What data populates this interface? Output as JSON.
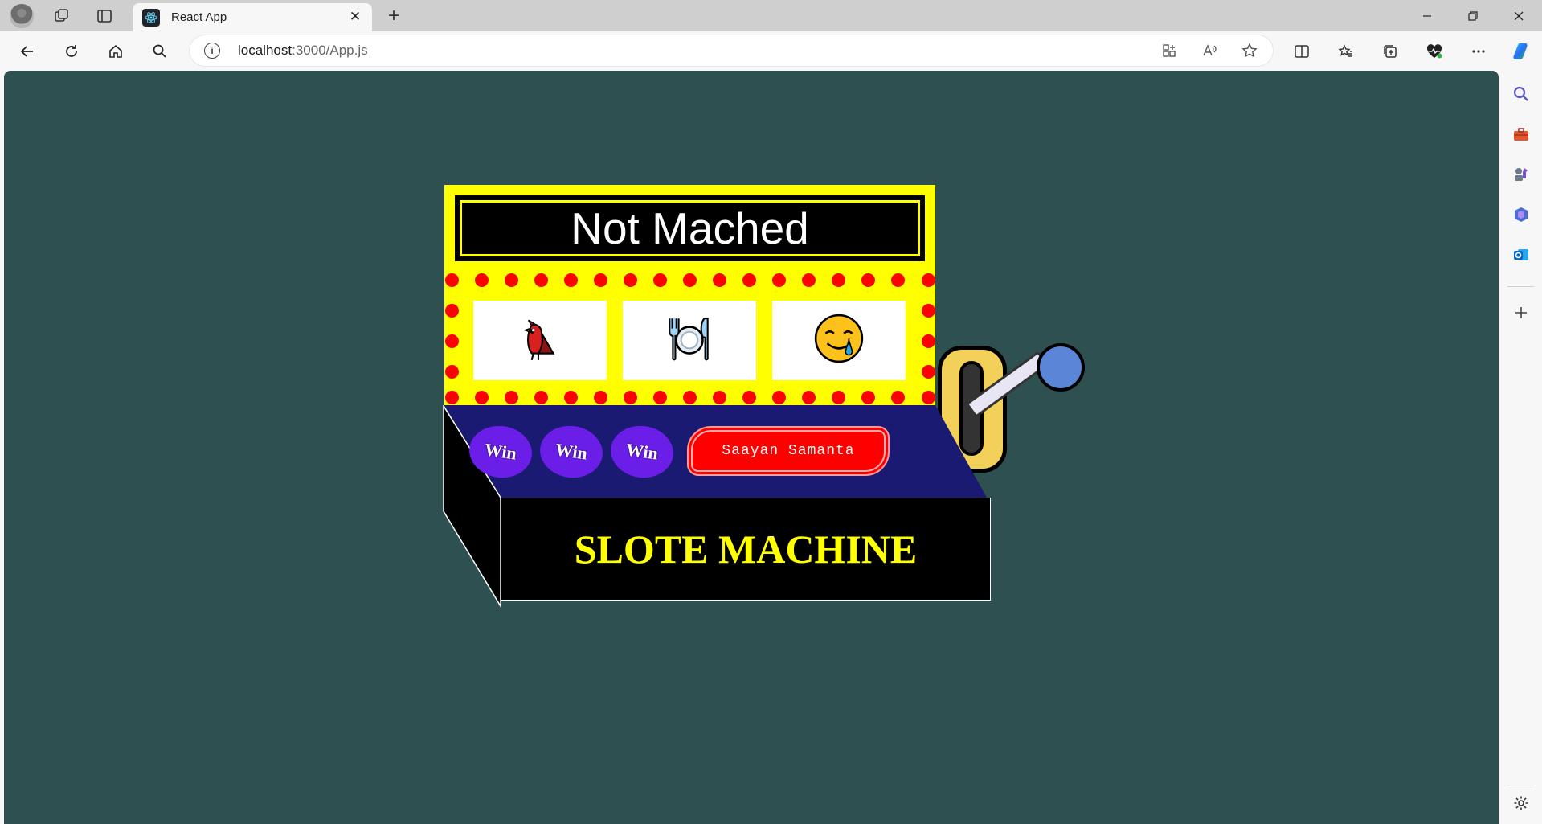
{
  "browser": {
    "tab_title": "React App",
    "url_host": "localhost",
    "url_rest": ":3000/App.js",
    "new_tab_glyph": "+",
    "close_tab_glyph": "✕"
  },
  "icons": {
    "avatar": "profile-avatar",
    "workspaces": "workspaces-icon",
    "tab_actions": "tab-actions-icon",
    "back": "back-icon",
    "refresh": "refresh-icon",
    "home": "home-icon",
    "search": "search-icon",
    "info": "site-info-icon"
  },
  "slot_machine": {
    "result_text": "Not Mached",
    "reels": [
      "🐦",
      "🍽",
      "🥲"
    ],
    "win_buttons": [
      "Win",
      "Win",
      "Win"
    ],
    "name_button": "Saayan Samanta",
    "title": "SLOTE MACHINE",
    "colors": {
      "background": "#2f5050",
      "marquee": "#ffff00",
      "lights": "#ff0000",
      "deck": "#1a1a72",
      "win_button": "#6a1ee8",
      "name_button": "#ff0000",
      "title_text": "#ffff00"
    }
  }
}
